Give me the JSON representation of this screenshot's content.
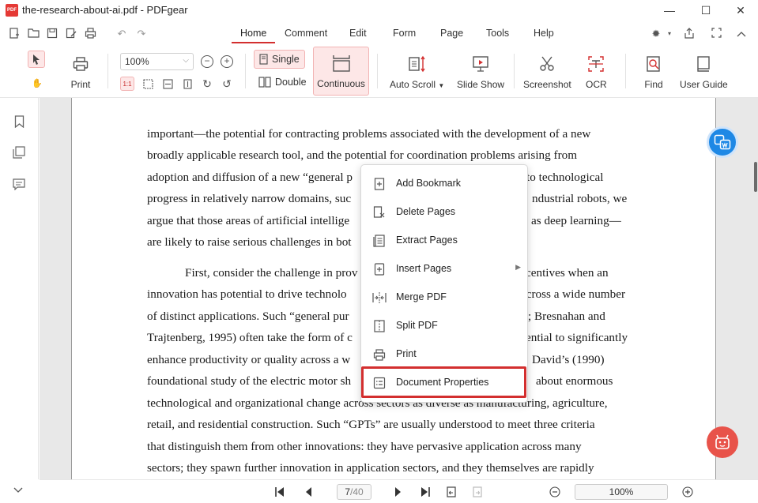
{
  "window": {
    "title": "the-research-about-ai.pdf - PDFgear",
    "logo_text": "PDF",
    "minimize_glyph": "—",
    "maximize_glyph": "☐",
    "close_glyph": "✕"
  },
  "menu": {
    "tabs": [
      {
        "label": "Home",
        "active": true
      },
      {
        "label": "Comment"
      },
      {
        "label": "Edit"
      },
      {
        "label": "Form"
      },
      {
        "label": "Page"
      },
      {
        "label": "Tools"
      },
      {
        "label": "Help"
      }
    ]
  },
  "toolbar": {
    "print_label": "Print",
    "zoom_value": "100%",
    "single_label": "Single",
    "double_label": "Double",
    "continuous_label": "Continuous",
    "auto_scroll_label": "Auto Scroll",
    "slide_show_label": "Slide Show",
    "screenshot_label": "Screenshot",
    "ocr_label": "OCR",
    "find_label": "Find",
    "user_guide_label": "User Guide",
    "actual_size_label": "1:1"
  },
  "document": {
    "lines": [
      "important—the potential for contracting problems associated with the development of a new",
      "broadly applicable research tool, and the potential for coordination problems arising from",
      "adoption and diffusion of a new “general p",
      "to technological",
      "progress in relatively narrow domains, suc",
      "ndustrial robots, we",
      "argue that those areas of artificial intellige",
      "as deep learning—",
      "are likely to raise serious challenges in bot",
      "First, consider the challenge in prov",
      "centives when an",
      "innovation has potential to drive technolo",
      "across a wide number",
      "of distinct applications.  Such “general pur",
      "; Bresnahan and",
      "Trajtenberg, 1995) often take the form of c",
      "ential to significantly",
      "enhance productivity or quality across a w",
      "David’s (1990)",
      "foundational study of the electric motor sh",
      "about enormous",
      "technological and organizational change across sectors as diverse as manufacturing, agriculture,",
      "retail, and residential construction.  Such “GPTs” are usually understood to meet three criteria",
      "that distinguish them from other innovations: they have pervasive application across many",
      "sectors; they spawn further innovation in application sectors, and they themselves are rapidly"
    ]
  },
  "context_menu": {
    "items": [
      {
        "label": "Add Bookmark",
        "icon": "bookmark-add-icon"
      },
      {
        "label": "Delete Pages",
        "icon": "delete-pages-icon"
      },
      {
        "label": "Extract Pages",
        "icon": "extract-pages-icon"
      },
      {
        "label": "Insert Pages",
        "icon": "insert-pages-icon",
        "submenu": true
      },
      {
        "label": "Merge PDF",
        "icon": "merge-pdf-icon"
      },
      {
        "label": "Split PDF",
        "icon": "split-pdf-icon"
      },
      {
        "label": "Print",
        "icon": "print-icon"
      },
      {
        "label": "Document Properties",
        "icon": "document-properties-icon",
        "highlighted": true
      }
    ]
  },
  "bottom": {
    "current_page": "7",
    "total_pages": "/40",
    "zoom": "100%"
  },
  "colors": {
    "accent": "#d32f2f",
    "translate_button": "#1e88e5",
    "assistant_button": "#e8534a"
  }
}
